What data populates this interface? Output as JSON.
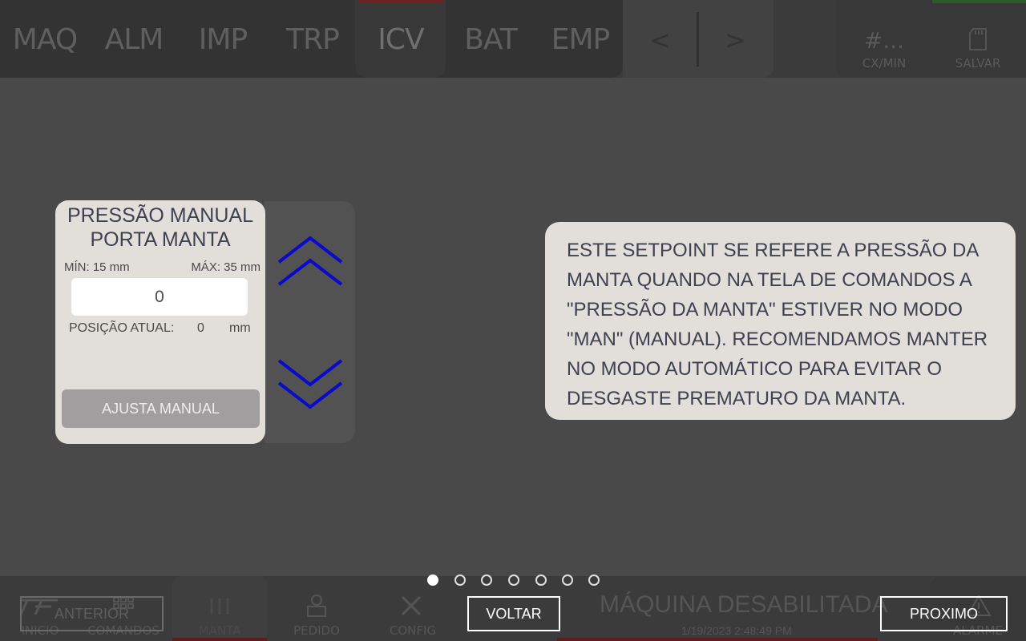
{
  "topbar": {
    "tabs": [
      {
        "label": "MAQ"
      },
      {
        "label": "ALM"
      },
      {
        "label": "IMP"
      },
      {
        "label": "TRP"
      },
      {
        "label": "ICV"
      },
      {
        "label": "BAT"
      },
      {
        "label": "EMP"
      }
    ],
    "prev_arrow": "<",
    "next_arrow": ">",
    "counter_value": "#...",
    "counter_unit": "CX/MIN",
    "save_label": "SALVAR"
  },
  "bottombar": {
    "nav": [
      {
        "label": "INICIO"
      },
      {
        "label": "COMANDOS"
      },
      {
        "label": "MANTA"
      },
      {
        "label": "PEDIDO"
      },
      {
        "label": "CONFIG"
      }
    ],
    "status": "MÁQUINA DESABILITADA",
    "datetime": "1/19/2023 2:48:49 PM",
    "alarm_label": "ALARME"
  },
  "panel": {
    "title_line1": "PRESSÃO MANUAL",
    "title_line2": "PORTA MANTA",
    "min_label": "MÍN: 15 mm",
    "max_label": "MÁX: 35 mm",
    "value": "0",
    "position_label": "POSIÇÃO ATUAL:",
    "position_value": "0",
    "position_unit": "mm",
    "adjust_label": "AJUSTA MANUAL",
    "chevron_color": "#0a0acc"
  },
  "info": {
    "text": "ESTE SETPOINT SE REFERE A PRESSÃO DA\nMANTA QUANDO NA TELA DE COMANDOS A\n\"PRESSÃO DA MANTA\" ESTIVER NO MODO\n\"MAN\" (MANUAL). RECOMENDAMOS MANTER\nNO MODO AUTOMÁTICO PARA EVITAR O\nDESGASTE PREMATURO DA MANTA."
  },
  "tour": {
    "prev_label": "ANTERIOR",
    "back_label": "VOLTAR",
    "next_label": "PROXIMO",
    "page_count": 7,
    "current_page": 1
  }
}
